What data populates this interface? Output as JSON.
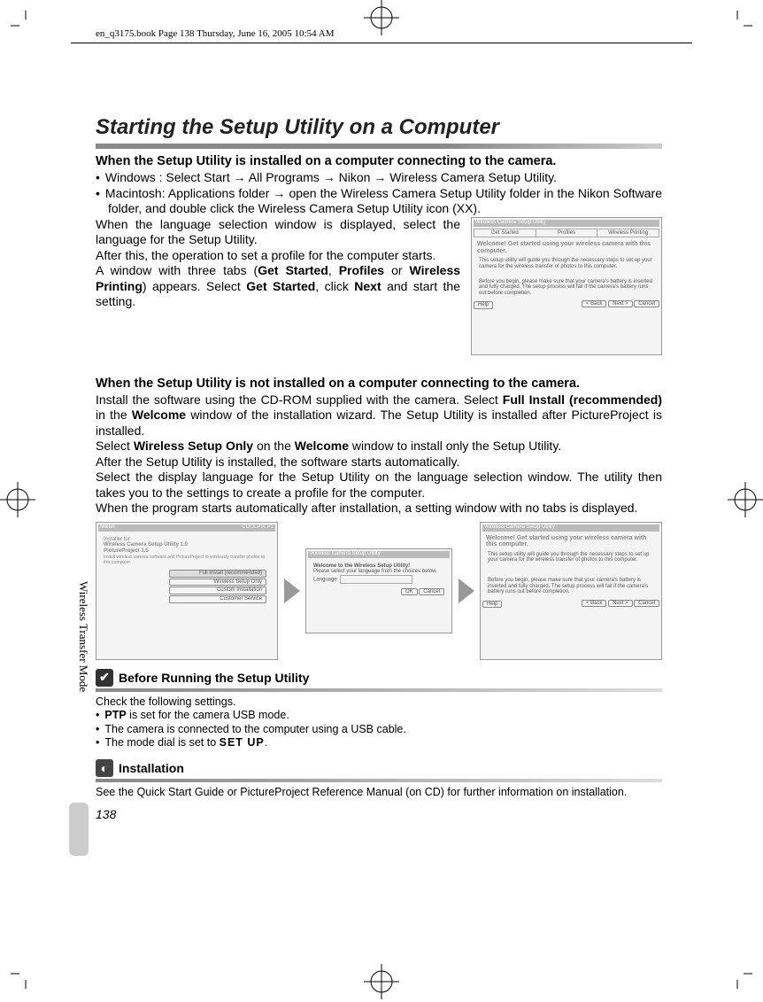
{
  "meta": {
    "header": "en_q3175.book  Page 138  Thursday, June 16, 2005  10:54 AM"
  },
  "sidebar": {
    "label": "Wireless Transfer Mode"
  },
  "page_number": "138",
  "h1": "Starting the Setup Utility on a Computer",
  "sec1": {
    "heading": "When the Setup Utility is installed on a computer connecting to the camera.",
    "li1": "Windows   : Select Start → All Programs → Nikon → Wireless Camera Setup Utility.",
    "li2": "Macintosh: Applications folder → open the Wireless Camera Setup Utility folder in the Nikon Software folder, and double click the Wireless Camera Setup Utility icon (XX).",
    "p1": "When the language selection window is displayed, select the language for the Setup Utility.",
    "p2": "After this, the operation to set a profile for the computer starts.",
    "p3a": "A window with three tabs (",
    "p3b": "Get Started",
    "p3c": ", ",
    "p3d": "Profiles",
    "p3e": " or ",
    "p3f": "Wireless Printing",
    "p3g": ") appears. Select ",
    "p3h": "Get Started",
    "p3i": ", click ",
    "p3j": "Next",
    "p3k": " and start the setting."
  },
  "shot1": {
    "title": "Wireless Camera Setup Utility",
    "tabs": [
      "Get Started",
      "Profiles",
      "Wireless Printing"
    ],
    "head": "Welcome! Get started using your wireless camera with this computer.",
    "txt1": "This setup utility will guide you through the necessary steps to set up your camera for the wireless transfer of photos to this computer.",
    "txt2": "Before you begin, please make sure that your camera's battery is inserted and fully charged. The setup process will fail if the camera's battery runs out before completion.",
    "help": "Help",
    "back": "< Back",
    "next": "Next >",
    "cancel": "Cancel"
  },
  "sec2": {
    "heading": "When the Setup Utility is not installed on a computer connecting to the camera.",
    "p1a": "Install the software using the CD-ROM supplied with the camera. Select ",
    "p1b": "Full Install (recommended)",
    "p1c": " in the ",
    "p1d": "Welcome",
    "p1e": " window of the installation wizard. The Setup Utility is installed after PictureProject is installed.",
    "p2a": "Select ",
    "p2b": "Wireless Setup Only",
    "p2c": " on the ",
    "p2d": "Welcome",
    "p2e": " window to install only the Setup Utility.",
    "p3": "After the Setup Utility is installed, the software starts automatically.",
    "p4": "Select the display language for the Setup Utility on the language selection window. The utility then takes you to the settings to create a profile for the computer.",
    "p5": "When the program starts automatically after installation, a setting window with no tabs is displayed."
  },
  "shotA": {
    "brand": "Nikon",
    "prod": "COOLPIX P1",
    "t1": "Installer for",
    "t2": "Wireless Camera Setup Utility 1.0",
    "t3": "PictureProject 1.5",
    "desc": "Install wireless camera software and PictureProject to wirelessly transfer photos to this computer.",
    "b1": "Full Install (recommended)",
    "b2": "Wireless Setup Only",
    "b3": "Custom Installation",
    "b4": "Customer Service"
  },
  "shotB": {
    "title": "Wireless Camera Setup Utility",
    "h": "Welcome to the Wireless Setup Utility!",
    "p": "Please select your language from the choices below.",
    "lang": "Language:",
    "ok": "OK",
    "cancel": "Cancel"
  },
  "before": {
    "title": "Before Running the Setup Utility",
    "intro": "Check the following settings.",
    "li1a": "PTP",
    "li1b": " is set for the camera USB mode.",
    "li2": "The camera is connected to the computer using a USB cable.",
    "li3a": "The mode dial is set to ",
    "li3b": "SET UP",
    "li3c": "."
  },
  "install": {
    "title": "Installation",
    "p": "See the Quick Start Guide or PictureProject Reference Manual (on CD) for further information on installation."
  }
}
